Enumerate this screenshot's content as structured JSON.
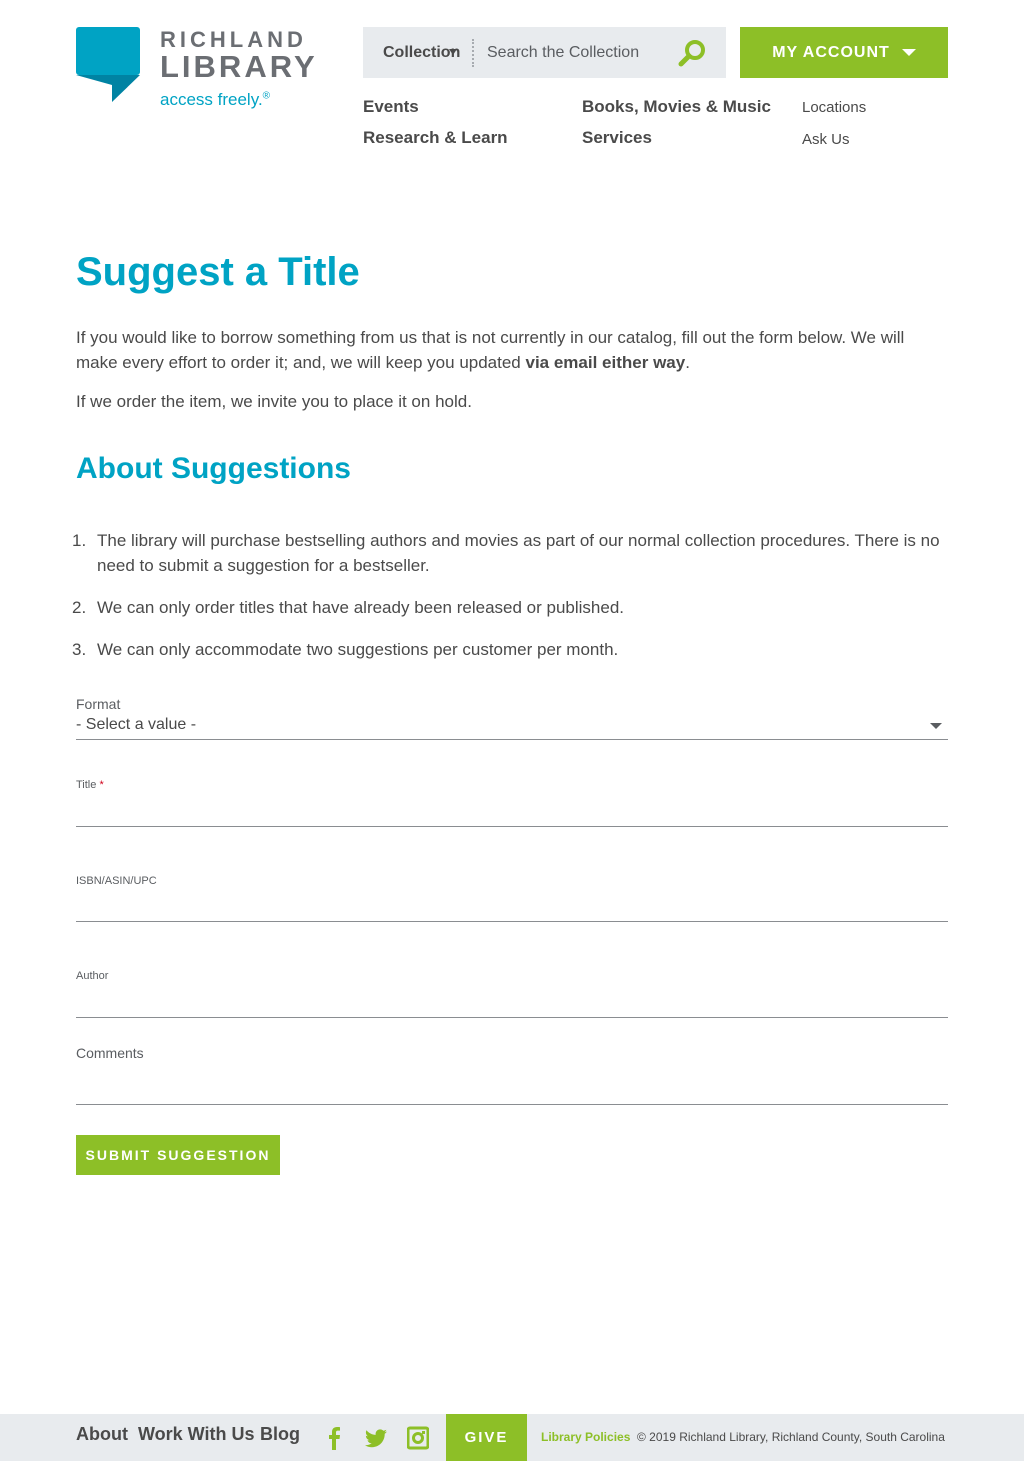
{
  "header": {
    "logo": {
      "line1": "RICHLAND",
      "line2": "LIBRARY",
      "tagline": "access freely.",
      "tagline_mark": "®"
    },
    "search": {
      "scope": "Collection",
      "placeholder": "Search the Collection",
      "icon": "search-icon"
    },
    "account": {
      "label": "MY ACCOUNT",
      "icon": "chevron-down-icon"
    },
    "nav": {
      "events": "Events",
      "research": "Research & Learn",
      "books": "Books, Movies & Music",
      "services": "Services",
      "locations": "Locations",
      "ask": "Ask Us"
    }
  },
  "main": {
    "title": "Suggest a Title",
    "intro_part1": "If you would like to borrow something from us that is not currently in our catalog, fill out the form below. We will make every effort to order it; and, we will keep you updated ",
    "intro_bold": "via email either way",
    "intro_end": ".",
    "intro2": "If we order the item, we invite you to place it on hold.",
    "section_title": "About Suggestions",
    "rules": [
      {
        "num": "1.",
        "text": "The library will purchase bestselling authors and movies as part of our normal collection procedures. There is no need to submit a suggestion for a bestseller."
      },
      {
        "num": "2.",
        "text": "We can only order titles that have already been released or published."
      },
      {
        "num": "3.",
        "text": "We can only accommodate two suggestions per customer per month."
      }
    ]
  },
  "form": {
    "format": {
      "label": "Format",
      "value": "- Select a value -"
    },
    "title": {
      "label": "Title",
      "required_mark": "*",
      "value": ""
    },
    "isbn": {
      "label": "ISBN/ASIN/UPC",
      "value": ""
    },
    "author": {
      "label": "Author",
      "value": ""
    },
    "comments": {
      "label": "Comments",
      "value": ""
    },
    "submit_label": "SUBMIT SUGGESTION"
  },
  "footer": {
    "links": {
      "about": "About",
      "work": "Work With Us",
      "blog": "Blog"
    },
    "social": [
      "facebook-icon",
      "twitter-icon",
      "instagram-icon"
    ],
    "give": "GIVE",
    "policies": "Library Policies",
    "copyright": "© 2019 Richland Library, Richland County, South Carolina"
  },
  "colors": {
    "brand_blue": "#00a3c4",
    "brand_green": "#8dbf27",
    "text": "#4a4a4a",
    "search_bg": "#e8ebee",
    "required": "#d0021b"
  }
}
